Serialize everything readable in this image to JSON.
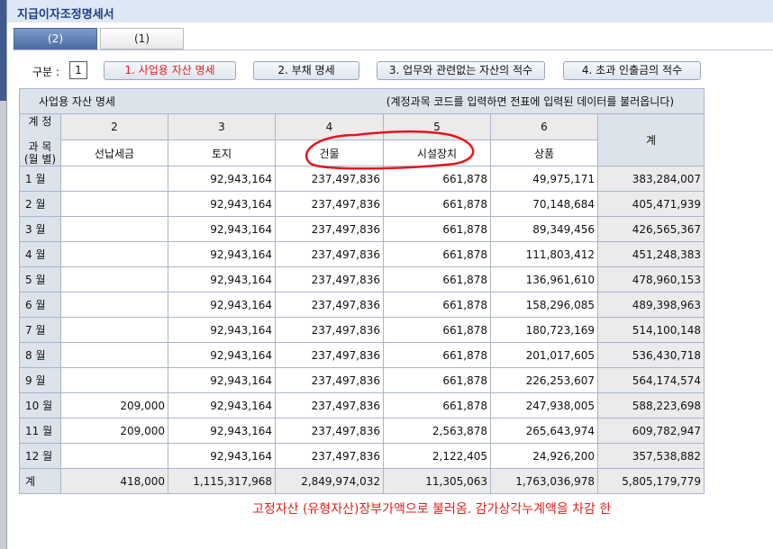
{
  "window_title": "지급이자조정명세서",
  "tabs": [
    {
      "label": "(2)",
      "active": true
    },
    {
      "label": "(1)",
      "active": false
    }
  ],
  "gubun": {
    "label": "구분 :",
    "value": "1"
  },
  "buttons": [
    "1. 사업용 자산 명세",
    "2. 부채 명세",
    "3. 업무와 관련없는 자산의 적수",
    "4. 초과 인출금의 적수"
  ],
  "table": {
    "title": "사업용 자산 명세",
    "hint": "(계정과목 코드를 입력하면 전표에 입력된 데이터를 불러옵니다)",
    "corner_top": "계 정",
    "corner_bottom": "과 목\n(월 별)",
    "codes": [
      "2",
      "3",
      "4",
      "5",
      "6"
    ],
    "names": [
      "선납세금",
      "토지",
      "건물",
      "시설장치",
      "상품"
    ],
    "total_header": "계",
    "rows": [
      {
        "month": "1 월",
        "v": [
          "",
          "92,943,164",
          "237,497,836",
          "661,878",
          "49,975,171"
        ],
        "total": "383,284,007"
      },
      {
        "month": "2 월",
        "v": [
          "",
          "92,943,164",
          "237,497,836",
          "661,878",
          "70,148,684"
        ],
        "total": "405,471,939"
      },
      {
        "month": "3 월",
        "v": [
          "",
          "92,943,164",
          "237,497,836",
          "661,878",
          "89,349,456"
        ],
        "total": "426,565,367"
      },
      {
        "month": "4 월",
        "v": [
          "",
          "92,943,164",
          "237,497,836",
          "661,878",
          "111,803,412"
        ],
        "total": "451,248,383"
      },
      {
        "month": "5 월",
        "v": [
          "",
          "92,943,164",
          "237,497,836",
          "661,878",
          "136,961,610"
        ],
        "total": "478,960,153"
      },
      {
        "month": "6 월",
        "v": [
          "",
          "92,943,164",
          "237,497,836",
          "661,878",
          "158,296,085"
        ],
        "total": "489,398,963"
      },
      {
        "month": "7 월",
        "v": [
          "",
          "92,943,164",
          "237,497,836",
          "661,878",
          "180,723,169"
        ],
        "total": "514,100,148"
      },
      {
        "month": "8 월",
        "v": [
          "",
          "92,943,164",
          "237,497,836",
          "661,878",
          "201,017,605"
        ],
        "total": "536,430,718"
      },
      {
        "month": "9 월",
        "v": [
          "",
          "92,943,164",
          "237,497,836",
          "661,878",
          "226,253,607"
        ],
        "total": "564,174,574"
      },
      {
        "month": "10 월",
        "v": [
          "209,000",
          "92,943,164",
          "237,497,836",
          "661,878",
          "247,938,005"
        ],
        "total": "588,223,698"
      },
      {
        "month": "11 월",
        "v": [
          "209,000",
          "92,943,164",
          "237,497,836",
          "2,563,878",
          "265,643,974"
        ],
        "total": "609,782,947"
      },
      {
        "month": "12 월",
        "v": [
          "",
          "92,943,164",
          "237,497,836",
          "2,122,405",
          "24,926,200"
        ],
        "total": "357,538,882"
      }
    ],
    "sum_row": {
      "label": "계",
      "v": [
        "418,000",
        "1,115,317,968",
        "2,849,974,032",
        "11,305,063",
        "1,763,036,978"
      ],
      "total": "5,805,179,779"
    }
  },
  "annotation": "고정자산 (유형자산)장부가액으로 불러옴. 감가상각누계액을 차감 한",
  "colors": {
    "accent": "#1f3f86",
    "annotation": "#e0201e"
  }
}
